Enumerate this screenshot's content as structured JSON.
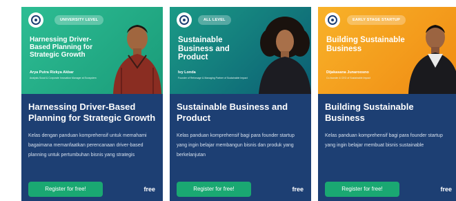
{
  "cards": [
    {
      "badge": "UNIVERSITY LEVEL",
      "hero_title": "Harnessing Driver-Based Planning for Strategic Growth",
      "speaker_name": "Arya Putra Rizkya Akbar",
      "speaker_role": "Analysis Scout & Corporate Innovation Manager at Ecosystem",
      "title": "Harnessing Driver-Based Planning for Strategic Growth",
      "description": "Kelas dengan panduan komprehensif untuk memahami bagaimana memanfaatkan perencanaan driver-based planning untuk pertumbuhan bisnis yang strategis",
      "cta": "Register for free!",
      "price": "free"
    },
    {
      "badge": "ALL LEVEL",
      "hero_title": "Sustainable Business and Product",
      "speaker_name": "Ivy Londa",
      "speaker_role": "Founder of Reforsage & Managing Partner of Sustainable Impact",
      "title": "Sustainable Business and Product",
      "description": "Kelas panduan komprehensif bagi para founder startup yang ingin belajar membangun bisnis dan produk yang berkelanjutan",
      "cta": "Register for free!",
      "price": "free"
    },
    {
      "badge": "EARLY STAGE STARTUP",
      "hero_title": "Building Sustainable Business",
      "speaker_name": "Dijakasana Junaroosno",
      "speaker_role": "Co-founder & CEO of Sustainable Impact",
      "title": "Building Sustainable Business",
      "description": "Kelas panduan komprehensif bagi para founder startup yang ingin belajar membuat bisnis sustainable",
      "cta": "Register for free!",
      "price": "free"
    }
  ],
  "colors": {
    "card_body": "#1d3f73",
    "button": "#1aa872",
    "hero_green": "#2dbd93",
    "hero_teal": "#0b5d73",
    "hero_orange": "#f8b229"
  },
  "icons": {
    "logo": "organization-logo-icon",
    "speaker": "speaker-portrait"
  }
}
